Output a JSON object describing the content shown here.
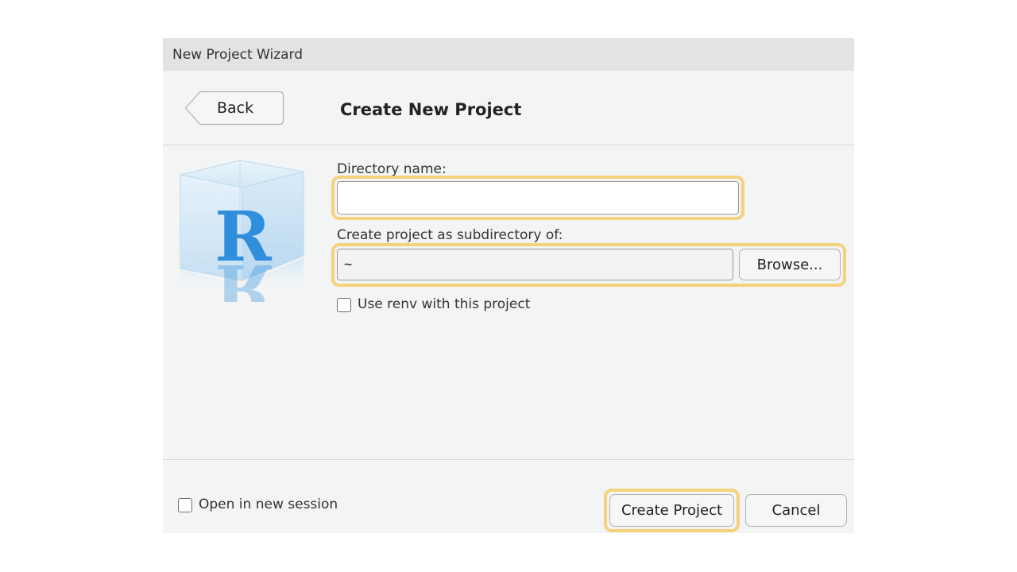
{
  "window": {
    "title": "New Project Wizard"
  },
  "header": {
    "back_label": "Back",
    "heading": "Create New Project"
  },
  "form": {
    "directory_name": {
      "label": "Directory name:",
      "value": ""
    },
    "parent_dir": {
      "label": "Create project as subdirectory of:",
      "value": "~",
      "browse_label": "Browse..."
    },
    "renv": {
      "label": "Use renv with this project",
      "checked": false
    }
  },
  "footer": {
    "open_new_session": {
      "label": "Open in new session",
      "checked": false
    },
    "create_label": "Create Project",
    "cancel_label": "Cancel"
  },
  "icons": {
    "logo": "r-logo-cube-icon",
    "back": "back-arrow-button-shape",
    "checkbox": "checkbox-icon"
  },
  "colors": {
    "highlight": "#f5d27c",
    "r_logo": "#2f8fdc",
    "dialog_bg": "#f3f4f4",
    "titlebar_bg": "#e3e3e3"
  }
}
